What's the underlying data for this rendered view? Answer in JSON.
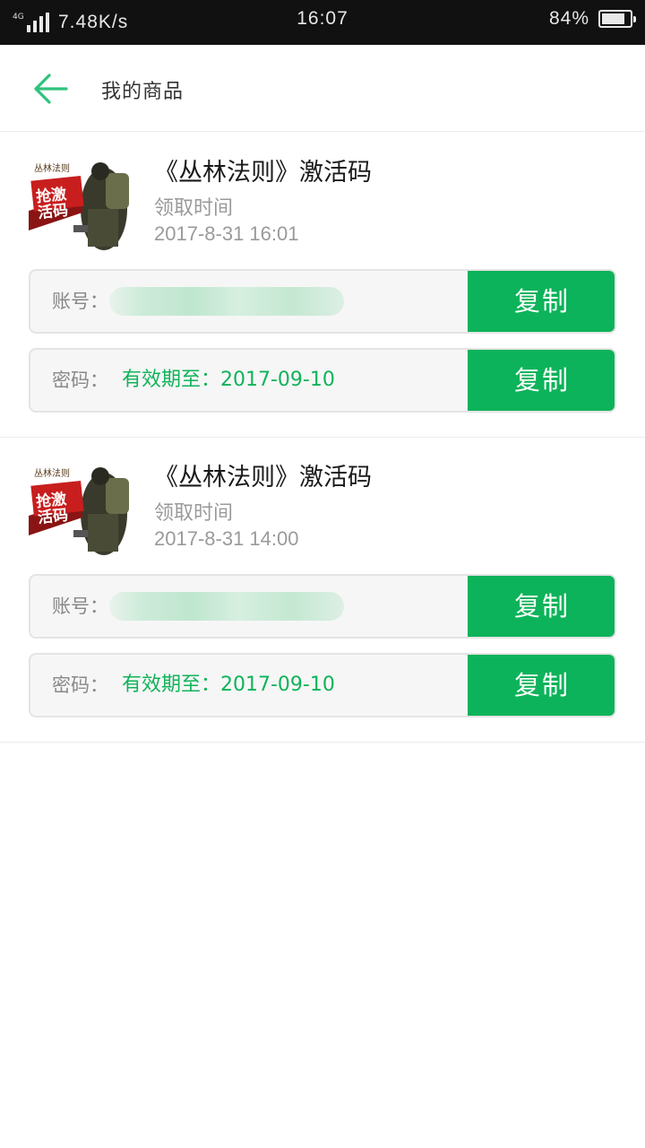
{
  "status_bar": {
    "network": "4G",
    "speed": "7.48K/s",
    "time": "16:07",
    "battery": "84%",
    "battery_level": 0.84
  },
  "header": {
    "back_icon": "arrow-left-icon",
    "title": "我的商品"
  },
  "colors": {
    "accent": "#0db35a",
    "back_arrow": "#2ec27e",
    "status_bar_bg": "#111111"
  },
  "products": [
    {
      "title": "《丛林法则》激活码",
      "claim_label": "领取时间",
      "claim_time": "2017-8-31 16:01",
      "account_label": "账号：",
      "password_label": "密码：",
      "password_value": "有效期至：2017-09-10",
      "copy_label": "复制",
      "thumb_logo_text": "丛林法则",
      "thumb_badge_text": "抢激活码"
    },
    {
      "title": "《丛林法则》激活码",
      "claim_label": "领取时间",
      "claim_time": "2017-8-31 14:00",
      "account_label": "账号：",
      "password_label": "密码：",
      "password_value": "有效期至：2017-09-10",
      "copy_label": "复制",
      "thumb_logo_text": "丛林法则",
      "thumb_badge_text": "抢激活码"
    }
  ]
}
